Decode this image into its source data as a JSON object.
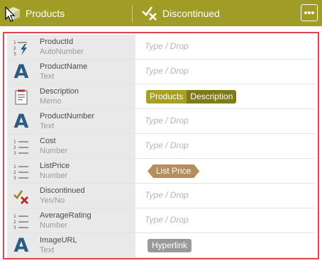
{
  "header": {
    "left_title": "Products",
    "right_title": "Discontinued",
    "more_label": "•••"
  },
  "fields": [
    {
      "name": "ProductId",
      "type": "AutoNumber",
      "icon": "autonumber-icon",
      "value_kind": "placeholder",
      "value": "Type / Drop"
    },
    {
      "name": "ProductName",
      "type": "Text",
      "icon": "text-icon",
      "value_kind": "placeholder",
      "value": "Type / Drop"
    },
    {
      "name": "Description",
      "type": "Memo",
      "icon": "memo-icon",
      "value_kind": "token-pair",
      "token1": "Products",
      "token2": "Description"
    },
    {
      "name": "ProductNumber",
      "type": "Text",
      "icon": "text-icon",
      "value_kind": "placeholder",
      "value": "Type / Drop"
    },
    {
      "name": "Cost",
      "type": "Number",
      "icon": "number-icon",
      "value_kind": "placeholder",
      "value": "Type / Drop"
    },
    {
      "name": "ListPrice",
      "type": "Number",
      "icon": "number-icon",
      "value_kind": "token-list",
      "token1": "List Price"
    },
    {
      "name": "Discontinued",
      "type": "Yes/No",
      "icon": "yes-no-icon",
      "value_kind": "placeholder",
      "value": "Type / Drop"
    },
    {
      "name": "AverageRating",
      "type": "Number",
      "icon": "number-icon",
      "value_kind": "placeholder",
      "value": "Type / Drop"
    },
    {
      "name": "ImageURL",
      "type": "Text",
      "icon": "text-icon",
      "value_kind": "token-link",
      "token1": "Hyperlink"
    }
  ],
  "colors": {
    "header_bg": "#a09c26",
    "frame_border": "#e0454f",
    "field_bg": "#e9e9e9",
    "text_icon": "#2b5c82",
    "products_token": "#a8a023",
    "description_token": "#7f7b1d",
    "list_price_token": "#b48e5e",
    "hyperlink_token": "#9a9a9a"
  }
}
